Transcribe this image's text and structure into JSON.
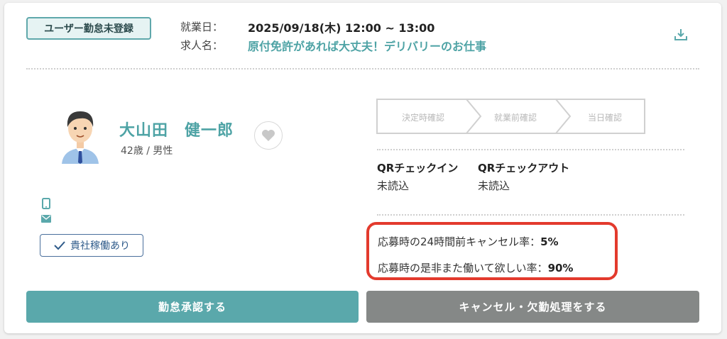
{
  "status_badge": "ユーザー勤怠未登録",
  "work_date": {
    "label": "就業日：",
    "value": "2025/09/18(木) 12:00 ~ 13:00"
  },
  "job_name": {
    "label": "求人名：",
    "value": "原付免許があれば大丈夫！デリバリーのお仕事"
  },
  "person": {
    "name": "大山田　健一郎",
    "sub": "42歳 / 男性"
  },
  "worked_badge": "貴社稼働あり",
  "steps": [
    "決定時確認",
    "就業前確認",
    "当日確認"
  ],
  "qr": {
    "checkin_label": "QRチェックイン",
    "checkin_value": "未読込",
    "checkout_label": "QRチェックアウト",
    "checkout_value": "未読込"
  },
  "rates": {
    "cancel_label": "応募時の24時間前キャンセル率：",
    "cancel_value": "5%",
    "rehire_label": "応募時の是非また働いて欲しい率：",
    "rehire_value": "90%"
  },
  "buttons": {
    "approve": "勤怠承認する",
    "cancel": "キャンセル・欠勤処理をする"
  },
  "colors": {
    "accent": "#5aa8ab",
    "highlight": "#e33a2d",
    "secondary": "#858887"
  }
}
